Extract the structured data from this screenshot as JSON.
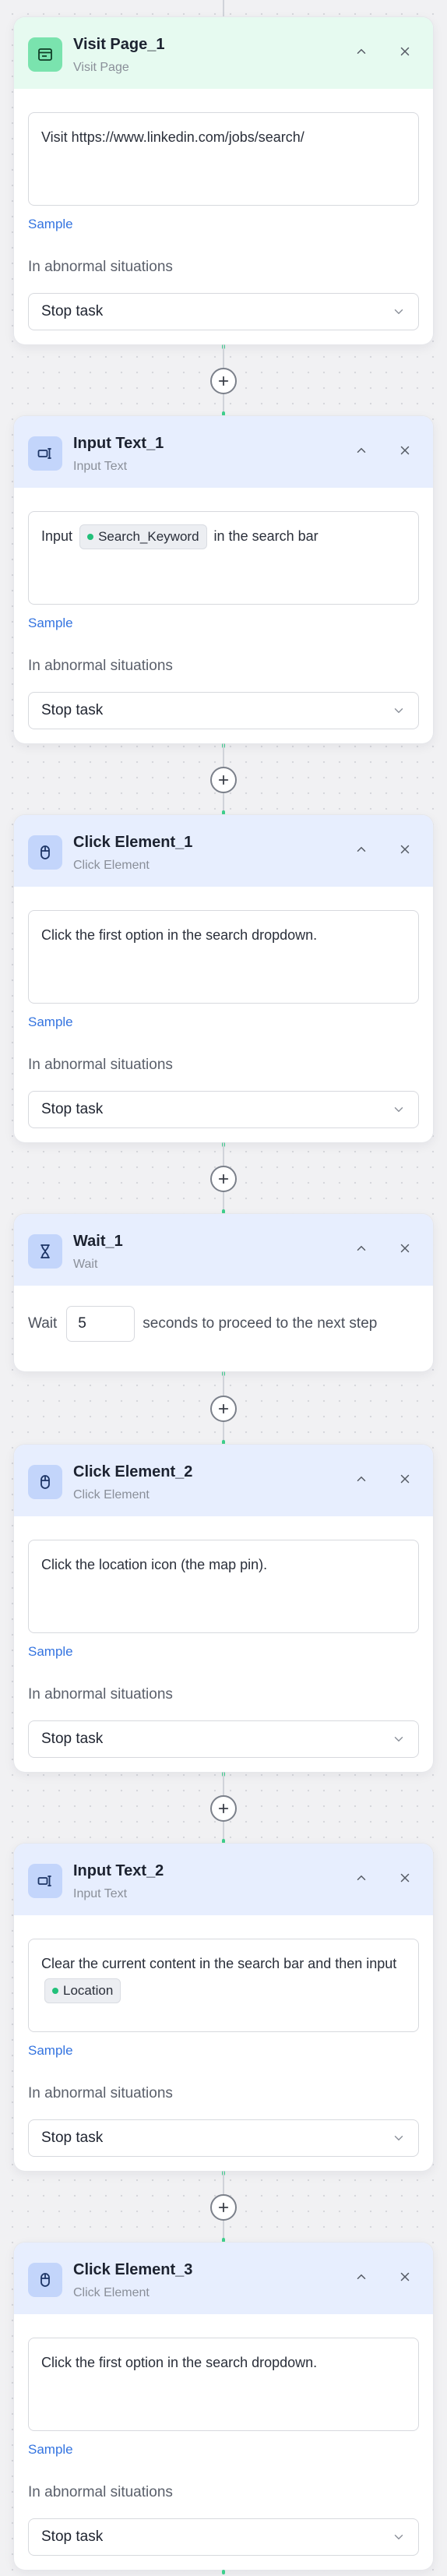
{
  "steps": [
    {
      "title": "Visit Page_1",
      "subtitle": "Visit Page",
      "icon": "browser-page-icon",
      "header_color": "#e6faf0",
      "instruction": "Visit https://www.linkedin.com/jobs/search/",
      "sample_label": "Sample",
      "abnormal_label": "In abnormal situations",
      "abnormal_value": "Stop task"
    },
    {
      "title": "Input Text_1",
      "subtitle": "Input Text",
      "icon": "keyboard-input-icon",
      "header_color": "#e7eefe",
      "instruction_before": "Input",
      "variable": "Search_Keyword",
      "instruction_after": "in the search bar",
      "sample_label": "Sample",
      "abnormal_label": "In abnormal situations",
      "abnormal_value": "Stop task"
    },
    {
      "title": "Click Element_1",
      "subtitle": "Click Element",
      "icon": "mouse-click-icon",
      "header_color": "#e7eefe",
      "instruction": "Click the first option in the search dropdown.",
      "sample_label": "Sample",
      "abnormal_label": "In abnormal situations",
      "abnormal_value": "Stop task"
    },
    {
      "title": "Wait_1",
      "subtitle": "Wait",
      "icon": "hourglass-icon",
      "header_color": "#e7eefe",
      "wait_before": "Wait",
      "wait_value": "5",
      "wait_after": "seconds to proceed to the next step"
    },
    {
      "title": "Click Element_2",
      "subtitle": "Click Element",
      "icon": "mouse-click-icon",
      "header_color": "#e7eefe",
      "instruction": "Click the location icon (the map pin).",
      "sample_label": "Sample",
      "abnormal_label": "In abnormal situations",
      "abnormal_value": "Stop task"
    },
    {
      "title": "Input Text_2",
      "subtitle": "Input Text",
      "icon": "keyboard-input-icon",
      "header_color": "#e7eefe",
      "instruction_before": "Clear the current content in the search bar and then input",
      "variable": "Location",
      "sample_label": "Sample",
      "abnormal_label": "In abnormal situations",
      "abnormal_value": "Stop task"
    },
    {
      "title": "Click Element_3",
      "subtitle": "Click Element",
      "icon": "mouse-click-icon",
      "header_color": "#e7eefe",
      "instruction": "Click the first option in the search dropdown.",
      "sample_label": "Sample",
      "abnormal_label": "In abnormal situations",
      "abnormal_value": "Stop task"
    }
  ],
  "colors": {
    "connector_accent": "#3fcf8e",
    "link": "#3474e0",
    "variable_dot": "#22c07a"
  }
}
